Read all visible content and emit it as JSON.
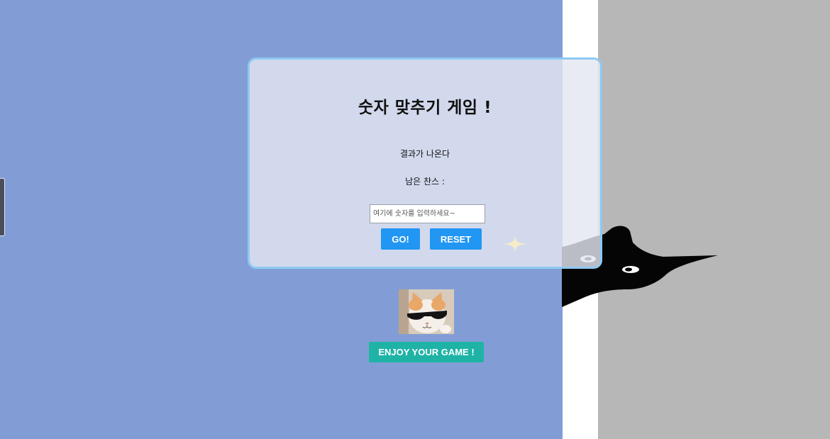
{
  "game": {
    "title": "숫자 맞추기 게임 !",
    "result_text": "결과가 나온다",
    "chance_label": "남은 찬스 :",
    "input": {
      "placeholder": "여기에 숫자를 입력하세요~",
      "value": ""
    },
    "go_label": "GO!",
    "reset_label": "RESET"
  },
  "footer": {
    "enjoy_label": "ENJOY YOUR GAME !"
  },
  "colors": {
    "background_blue": "#829dd6",
    "background_gray": "#b7b7b7",
    "card_border": "#8ec9f3",
    "button_blue": "#2196f3",
    "button_teal": "#1fb3a6"
  },
  "icons": {
    "sparkle": "sparkle-icon",
    "cat_silhouette": "black-cat-silhouette",
    "cat_photo": "cat-with-sunglasses"
  }
}
